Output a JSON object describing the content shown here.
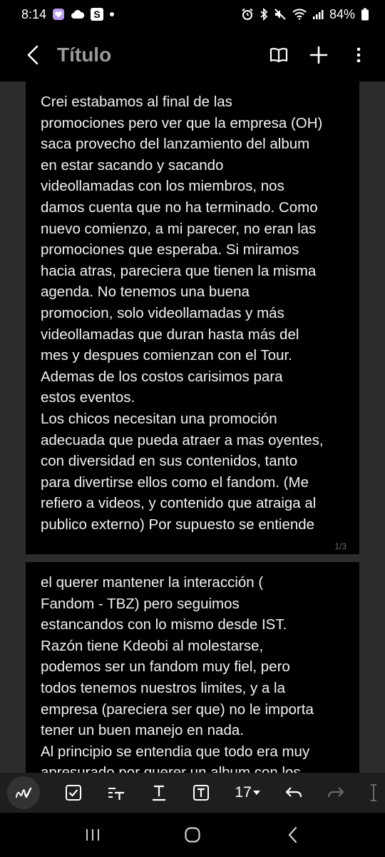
{
  "status_bar": {
    "time": "8:14",
    "battery": "84%"
  },
  "app_bar": {
    "title": "Título"
  },
  "pages": [
    {
      "text": "Crei estabamos al final de las\npromociones pero ver que la empresa (OH)\nsaca provecho del lanzamiento del album\nen estar sacando y sacando\nvideollamadas con los miembros, nos\ndamos cuenta que no ha terminado. Como\nnuevo comienzo, a mi parecer, no eran las\npromociones que esperaba. Si miramos\nhacia atras, pareciera que tienen la misma\nagenda. No tenemos una buena\npromocion, solo videollamadas y más\nvideollamadas que duran hasta más del\nmes y despues comienzan con el Tour.\nAdemas de los costos carisimos para\nestos eventos.\nLos chicos necesitan una promoción\nadecuada que pueda atraer a mas oyentes,\ncon diversidad en sus contenidos, tanto\npara divertirse ellos como el fandom. (Me\nrefiero a videos, y contenido que atraiga al\npublico externo) Por supuesto se entiende",
      "page_number": "1/3"
    },
    {
      "text": "el querer mantener la interacción (\nFandom - TBZ) pero seguimos\nestancandos con lo mismo desde IST.\nRazón tiene Kdeobi al molestarse,\npodemos ser un fandom muy fiel, pero\ntodos tenemos nuestros limites, y a la\nempresa (pareciera ser que) no le importa\ntener un buen manejo en nada.\nAl principio se entendia que todo era muy\napresurado por querer un album con los"
    }
  ],
  "toolbar": {
    "font_size": "17"
  },
  "colors": {
    "background": "#000000",
    "canvas": "#2d2d2d",
    "toolbar": "#1e1e1e",
    "title": "#9a9a9a"
  }
}
